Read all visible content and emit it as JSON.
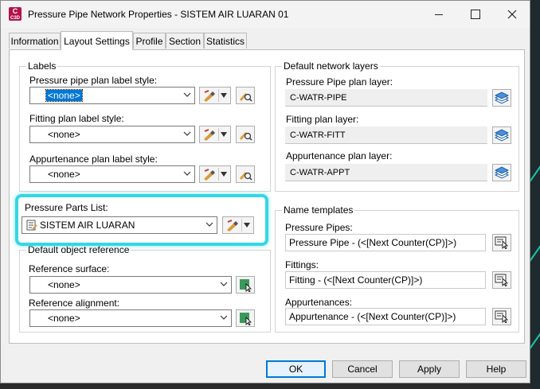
{
  "window": {
    "title": "Pressure Pipe Network Properties - SISTEM AIR LUARAN 01",
    "app_icon_text": "C",
    "app_icon_sub": "C3D"
  },
  "tabs": [
    {
      "label": "Information"
    },
    {
      "label": "Layout Settings"
    },
    {
      "label": "Profile"
    },
    {
      "label": "Section"
    },
    {
      "label": "Statistics"
    }
  ],
  "labels_group": {
    "legend": "Labels",
    "pipe_label": "Pressure pipe plan label style:",
    "pipe_value": "<none>",
    "fitting_label": "Fitting plan label style:",
    "fitting_value": "<none>",
    "appurtenance_label": "Appurtenance plan label style:",
    "appurtenance_value": "<none>"
  },
  "parts_list": {
    "label": "Pressure Parts List:",
    "value": "SISTEM AIR LUARAN"
  },
  "default_ref": {
    "legend": "Default object reference",
    "surface_label": "Reference surface:",
    "surface_value": "<none>",
    "alignment_label": "Reference alignment:",
    "alignment_value": "<none>"
  },
  "layers_group": {
    "legend": "Default network layers",
    "pipe_label": "Pressure Pipe plan layer:",
    "pipe_value": "C-WATR-PIPE",
    "fitting_label": "Fitting plan layer:",
    "fitting_value": "C-WATR-FITT",
    "appurtenance_label": "Appurtenance plan layer:",
    "appurtenance_value": "C-WATR-APPT"
  },
  "name_templates": {
    "legend": "Name templates",
    "pipes_label": "Pressure Pipes:",
    "pipes_value": "Pressure Pipe - (<[Next Counter(CP)]>)",
    "fittings_label": "Fittings:",
    "fittings_value": "Fitting - (<[Next Counter(CP)]>)",
    "appurtenances_label": "Appurtenances:",
    "appurtenances_value": "Appurtenance - (<[Next Counter(CP)]>)"
  },
  "footer": {
    "ok": "OK",
    "cancel": "Cancel",
    "apply": "Apply",
    "help": "Help"
  },
  "colors": {
    "highlight": "#35d6e5",
    "accent": "#0078d7",
    "app_icon": "#b3124a"
  }
}
